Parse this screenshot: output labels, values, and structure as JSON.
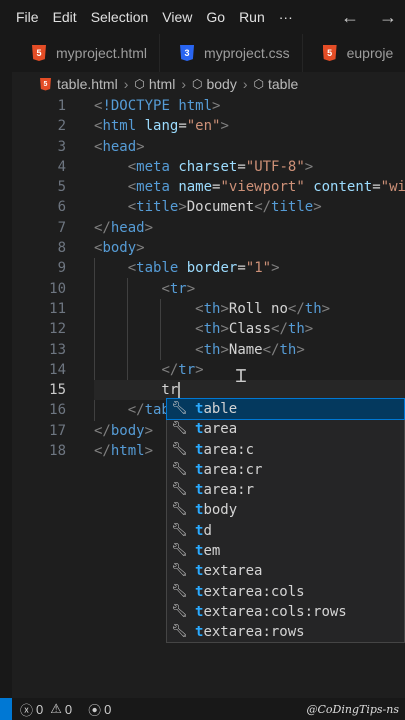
{
  "menu": {
    "items": [
      "File",
      "Edit",
      "Selection",
      "View",
      "Go",
      "Run",
      "···"
    ]
  },
  "tabs": [
    {
      "label": "myproject.html",
      "icon": "html5-icon"
    },
    {
      "label": "myproject.css",
      "icon": "css3-icon"
    },
    {
      "label": "euproje",
      "icon": "html5-icon"
    }
  ],
  "breadcrumb": [
    "table.html",
    "html",
    "body",
    "table"
  ],
  "editor": {
    "line_numbers": [
      "1",
      "2",
      "3",
      "4",
      "5",
      "6",
      "7",
      "8",
      "9",
      "10",
      "11",
      "12",
      "13",
      "14",
      "15",
      "16",
      "17",
      "18"
    ],
    "active_line": "15",
    "lines": [
      "<!DOCTYPE html>",
      "<html lang=\"en\">",
      "<head>",
      "    <meta charset=\"UTF-8\">",
      "    <meta name=\"viewport\" content=\"wid",
      "    <title>Document</title>",
      "</head>",
      "<body>",
      "    <table border=\"1\">",
      "        <tr>",
      "            <th>Roll no</th>",
      "            <th>Class</th>",
      "            <th>Name</th>",
      "        </tr>",
      "        tr",
      "    </tab",
      "</body>",
      "</html>"
    ]
  },
  "suggestions": [
    {
      "match": "t",
      "rest": "able"
    },
    {
      "match": "t",
      "rest": "area"
    },
    {
      "match": "t",
      "rest": "area:c"
    },
    {
      "match": "t",
      "rest": "area:cr"
    },
    {
      "match": "t",
      "rest": "area:r"
    },
    {
      "match": "t",
      "rest": "body"
    },
    {
      "match": "t",
      "rest": "d"
    },
    {
      "match": "t",
      "rest": "em"
    },
    {
      "match": "t",
      "rest": "extarea"
    },
    {
      "match": "t",
      "rest": "extarea:cols"
    },
    {
      "match": "t",
      "rest": "extarea:cols:rows"
    },
    {
      "match": "t",
      "rest": "extarea:rows"
    }
  ],
  "status": {
    "errors": "0",
    "warnings": "0",
    "ports": "0"
  },
  "watermark": "@CoDingTips-ns",
  "colors": {
    "accent": "#0078d4",
    "tag": "#569cd6",
    "attribute": "#9cdcfe",
    "string": "#ce9178"
  }
}
